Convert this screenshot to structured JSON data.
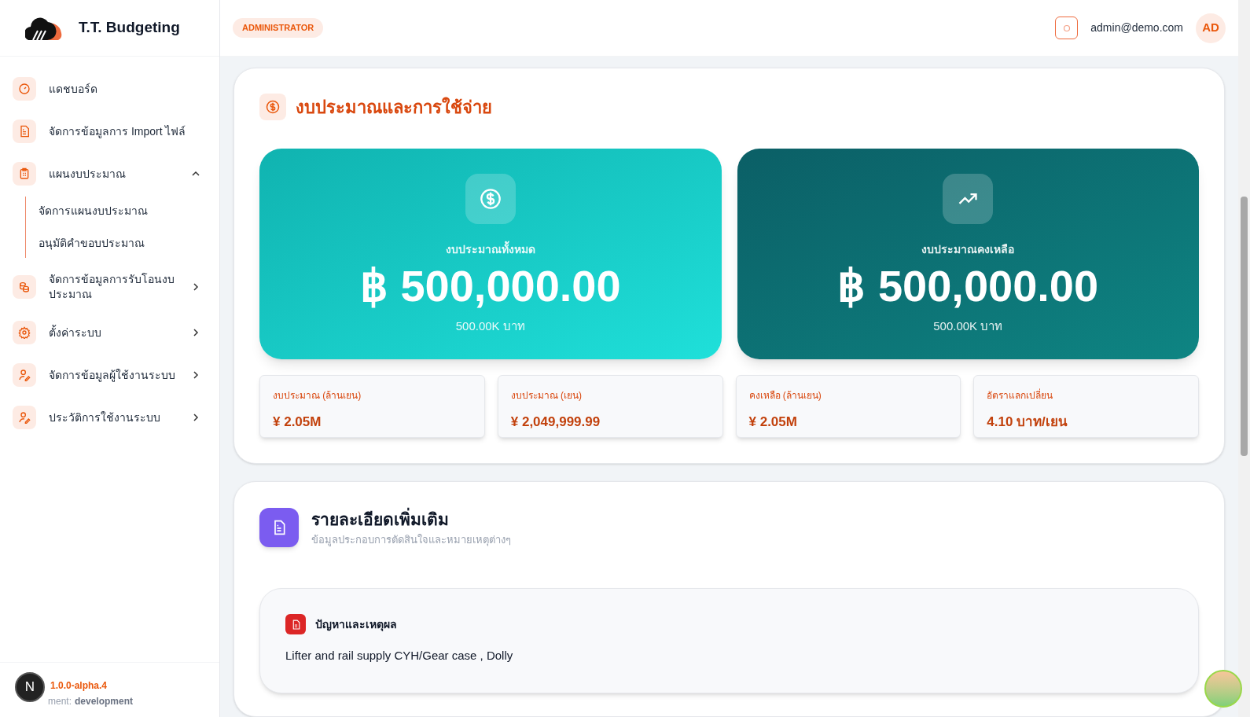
{
  "brand": {
    "name": "T.T. Budgeting"
  },
  "header": {
    "role_badge": "ADMINISTRATOR",
    "email": "admin@demo.com",
    "avatar": "AD"
  },
  "sidebar": {
    "items": [
      {
        "label": "แดชบอร์ด"
      },
      {
        "label": "จัดการข้อมูลการ Import ไฟล์"
      },
      {
        "label": "แผนงบประมาณ",
        "expanded": true,
        "children": [
          {
            "label": "จัดการแผนงบประมาณ"
          },
          {
            "label": "อนุมัติคำขอบประมาณ"
          }
        ]
      },
      {
        "label": "จัดการข้อมูลการรับโอนงบประมาณ",
        "expanded": false
      },
      {
        "label": "ตั้งค่าระบบ",
        "expanded": false
      },
      {
        "label": "จัดการข้อมูลผู้ใช้งานระบบ",
        "expanded": false
      },
      {
        "label": "ประวัติการใช้งานระบบ",
        "expanded": false
      }
    ],
    "footer": {
      "version": "1.0.0-alpha.4",
      "env_suffix": "ment:",
      "env": "development",
      "badge": "N"
    }
  },
  "budget_section": {
    "title": "งบประมาณและการใช้จ่าย",
    "hero_cards": [
      {
        "kind": "total",
        "label": "งบประมาณทั้งหมด",
        "amount": "฿ 500,000.00",
        "sub": "500.00K บาท"
      },
      {
        "kind": "remaining",
        "label": "งบประมาณคงเหลือ",
        "amount": "฿ 500,000.00",
        "sub": "500.00K บาท"
      }
    ],
    "stats": [
      {
        "label": "งบประมาณ (ล้านเยน)",
        "value": "¥ 2.05M"
      },
      {
        "label": "งบประมาณ (เยน)",
        "value": "¥ 2,049,999.99"
      },
      {
        "label": "คงเหลือ (ล้านเยน)",
        "value": "¥ 2.05M"
      },
      {
        "label": "อัตราแลกเปลี่ยน",
        "value": "4.10 บาท/เยน"
      }
    ]
  },
  "details_section": {
    "title": "รายละเอียดเพิ่มเติม",
    "subtitle": "ข้อมูลประกอบการตัดสินใจและหมายเหตุต่างๆ",
    "notes": [
      {
        "title": "ปัญหาและเหตุผล",
        "text": "Lifter and rail supply CYH/Gear case , Dolly"
      }
    ]
  }
}
